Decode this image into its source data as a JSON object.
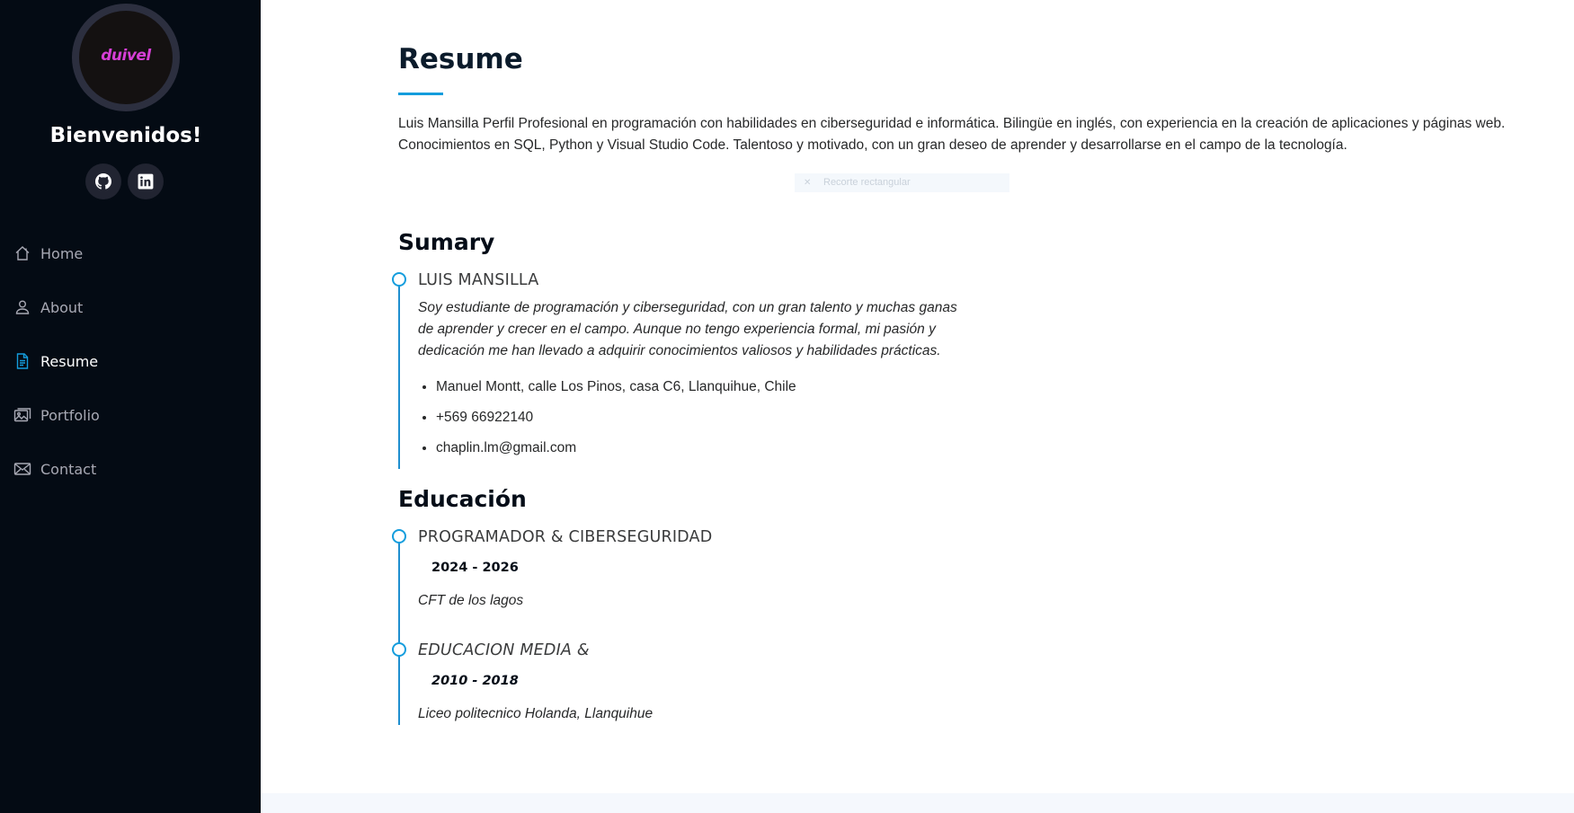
{
  "sidebar": {
    "logo_text": "duivel",
    "welcome": "Bienvenidos!",
    "social": [
      {
        "icon": "github-icon"
      },
      {
        "icon": "linkedin-icon"
      }
    ],
    "nav": [
      {
        "label": "Home",
        "icon": "home-icon",
        "active": false
      },
      {
        "label": "About",
        "icon": "person-icon",
        "active": false
      },
      {
        "label": "Resume",
        "icon": "file-text-icon",
        "active": true
      },
      {
        "label": "Portfolio",
        "icon": "images-icon",
        "active": false
      },
      {
        "label": "Contact",
        "icon": "envelope-icon",
        "active": false
      }
    ],
    "colors": {
      "background": "#040b14",
      "accent": "#149ddd",
      "logo": "#d63fd6"
    }
  },
  "main": {
    "title": "Resume",
    "intro": "Luis Mansilla Perfil Profesional en programación con habilidades en ciberseguridad e informática. Bilingüe en inglés, con experiencia en la creación de aplicaciones y páginas web. Conocimientos en SQL, Python y Visual Studio Code. Talentoso y motivado, con un gran deseo de aprender y desarrollarse en el campo de la tecnología.",
    "snip_overlay": "Recorte rectangular",
    "summary": {
      "title": "Sumary",
      "name": "LUIS MANSILLA",
      "description": "Soy estudiante de programación y ciberseguridad, con un gran talento y muchas ganas de aprender y crecer en el campo. Aunque no tengo experiencia formal, mi pasión y dedicación me han llevado a adquirir conocimientos valiosos y habilidades prácticas.",
      "details": [
        "Manuel Montt, calle Los Pinos, casa C6, Llanquihue, Chile",
        "+569 66922140",
        "chaplin.lm@gmail.com"
      ]
    },
    "education": {
      "title": "Educación",
      "items": [
        {
          "heading": "PROGRAMADOR & CIBERSEGURIDAD",
          "period": "2024 - 2026",
          "institution": "CFT de los lagos"
        },
        {
          "heading": "EDUCACION MEDIA &",
          "period": "2010 - 2018",
          "institution": "Liceo politecnico Holanda, Llanquihue"
        }
      ]
    }
  }
}
